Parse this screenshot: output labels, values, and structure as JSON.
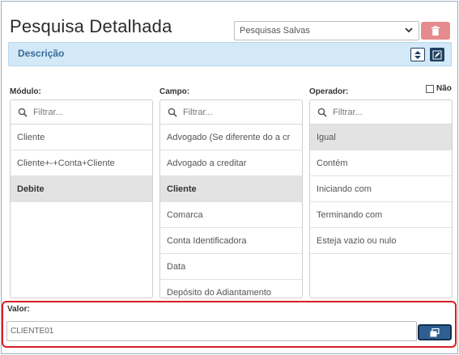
{
  "header": {
    "title": "Pesquisa Detalhada",
    "saved_searches_label": "Pesquisas Salvas"
  },
  "description_bar": {
    "label": "Descrição"
  },
  "columns": {
    "modulo": {
      "label": "Módulo:",
      "filter_placeholder": "Filtrar...",
      "items": [
        "Cliente",
        "Cliente+-+Conta+Cliente",
        "Debite"
      ],
      "selected": "Debite"
    },
    "campo": {
      "label": "Campo:",
      "filter_placeholder": "Filtrar...",
      "items": [
        "Advogado (Se diferente do a cr",
        "Advogado a creditar",
        "Cliente",
        "Comarca",
        "Conta Identificadora",
        "Data",
        "Depósito do Adiantamento"
      ],
      "selected": "Cliente"
    },
    "operador": {
      "label": "Operador:",
      "filter_placeholder": "Filtrar...",
      "items": [
        "Igual",
        "Contém",
        "Iniciando com",
        "Terminando com",
        "Esteja vazio ou nulo"
      ],
      "selected": "Igual",
      "not_label": "Não"
    }
  },
  "valor": {
    "label": "Valor:",
    "value": "CLIENTE01"
  },
  "colors": {
    "accent": "#2f5f92",
    "danger": "#e58b8e",
    "highlight_border": "#d81f26",
    "description_bg": "#d3e9f7"
  }
}
